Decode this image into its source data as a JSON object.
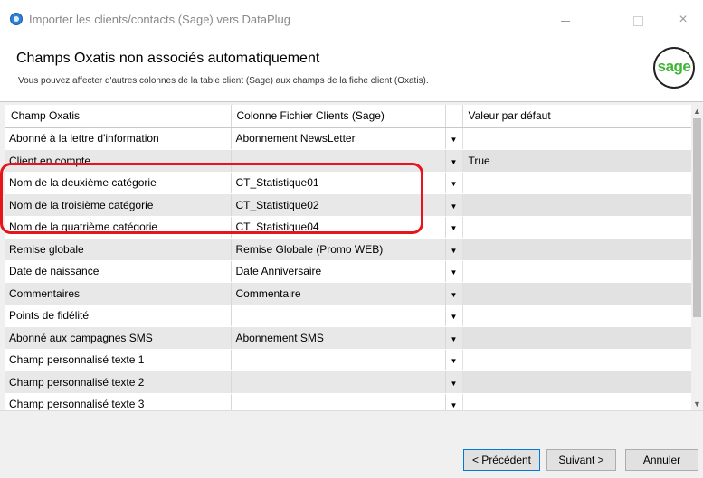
{
  "window": {
    "title": "Importer les clients/contacts (Sage) vers DataPlug",
    "minimize_icon": "minimize-icon",
    "maximize_icon": "maximize-icon",
    "close_glyph": "×"
  },
  "header": {
    "title": "Champs Oxatis non associés automatiquement",
    "subtitle": "Vous pouvez affecter d'autres colonnes de la table client (Sage) aux champs de la fiche client (Oxatis).",
    "logo_text": "sage",
    "logo_color": "#3fb536"
  },
  "grid": {
    "columns": [
      "Champ Oxatis",
      "Colonne Fichier Clients (Sage)",
      "",
      "Valeur par défaut"
    ],
    "rows": [
      {
        "field": "Abonné à la lettre d'information",
        "column": "Abonnement NewsLetter",
        "default": ""
      },
      {
        "field": "Client en compte",
        "column": "",
        "default": "True"
      },
      {
        "field": "Nom de la deuxième catégorie",
        "column": "CT_Statistique01",
        "default": ""
      },
      {
        "field": "Nom de la troisième catégorie",
        "column": "CT_Statistique02",
        "default": ""
      },
      {
        "field": "Nom de la quatrième catégorie",
        "column": "CT_Statistique04",
        "default": ""
      },
      {
        "field": "Remise globale",
        "column": "Remise Globale (Promo WEB)",
        "default": ""
      },
      {
        "field": "Date de naissance",
        "column": "Date Anniversaire",
        "default": ""
      },
      {
        "field": "Commentaires",
        "column": "Commentaire",
        "default": ""
      },
      {
        "field": "Points de fidélité",
        "column": "",
        "default": ""
      },
      {
        "field": "Abonné aux campagnes SMS",
        "column": "Abonnement SMS",
        "default": ""
      },
      {
        "field": "Champ personnalisé texte 1",
        "column": "",
        "default": ""
      },
      {
        "field": "Champ personnalisé texte 2",
        "column": "",
        "default": ""
      },
      {
        "field": "Champ personnalisé texte 3",
        "column": "",
        "default": ""
      }
    ],
    "dropdown_glyph": "▼",
    "highlight_color": "#e8141b"
  },
  "scrollbar": {
    "up": "▲",
    "down": "▼"
  },
  "footer": {
    "prev_label": "< Précédent",
    "next_label": "Suivant >",
    "cancel_label": "Annuler"
  }
}
